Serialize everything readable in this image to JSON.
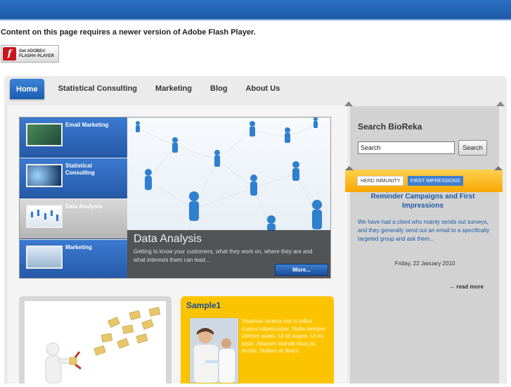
{
  "flash": {
    "message": "Content on this page requires a newer version of Adobe Flash Player.",
    "badge_line1": "Get ADOBE®",
    "badge_line2": "FLASH® PLAYER",
    "logo_icon": "flash-player-icon",
    "logo_letter": "f"
  },
  "nav": {
    "items": [
      {
        "label": "Home",
        "active": true
      },
      {
        "label": "Statistical Consulting",
        "active": false
      },
      {
        "label": "Marketing",
        "active": false
      },
      {
        "label": "Blog",
        "active": false
      },
      {
        "label": "About Us",
        "active": false
      }
    ]
  },
  "slider": {
    "thumbs": [
      {
        "label": "Email Marketing",
        "active": false
      },
      {
        "label": "Statistical Consulting",
        "active": false
      },
      {
        "label": "Data Analysis",
        "active": true
      },
      {
        "label": "Marketing",
        "active": false
      }
    ],
    "caption_title": "Data Analysis",
    "caption_text": "Getting to know your customers, what they work on, where they are and what interests them can lead...",
    "more_label": "More..."
  },
  "sample": {
    "title": "Sample1",
    "text": "Vivamus viverra nisi in tellus cursus ullamcorper. Nulla semper ultrices quam. Ut id augue. Ut eu justo. Aliquam blandit risus ac lectus. Nullam at libero."
  },
  "sidebar": {
    "title": "Search BioReka",
    "search_value": "Search",
    "search_button": "Search",
    "tabs": [
      "HERD IMMUNITY",
      "FIRST IMPRESSIONS"
    ],
    "post_title": "Reminder Campaigns and First Impressions",
    "post_text": "We have had a client who mainly sends out surveys, and they generally send out an email to a specifically targeted group and ask them...",
    "post_date": "Friday, 22 January 2010",
    "read_more": "→ read more"
  },
  "colors": {
    "brand_blue": "#1d5aa6",
    "accent_yellow": "#fcc400",
    "flash_red": "#c8161d"
  }
}
